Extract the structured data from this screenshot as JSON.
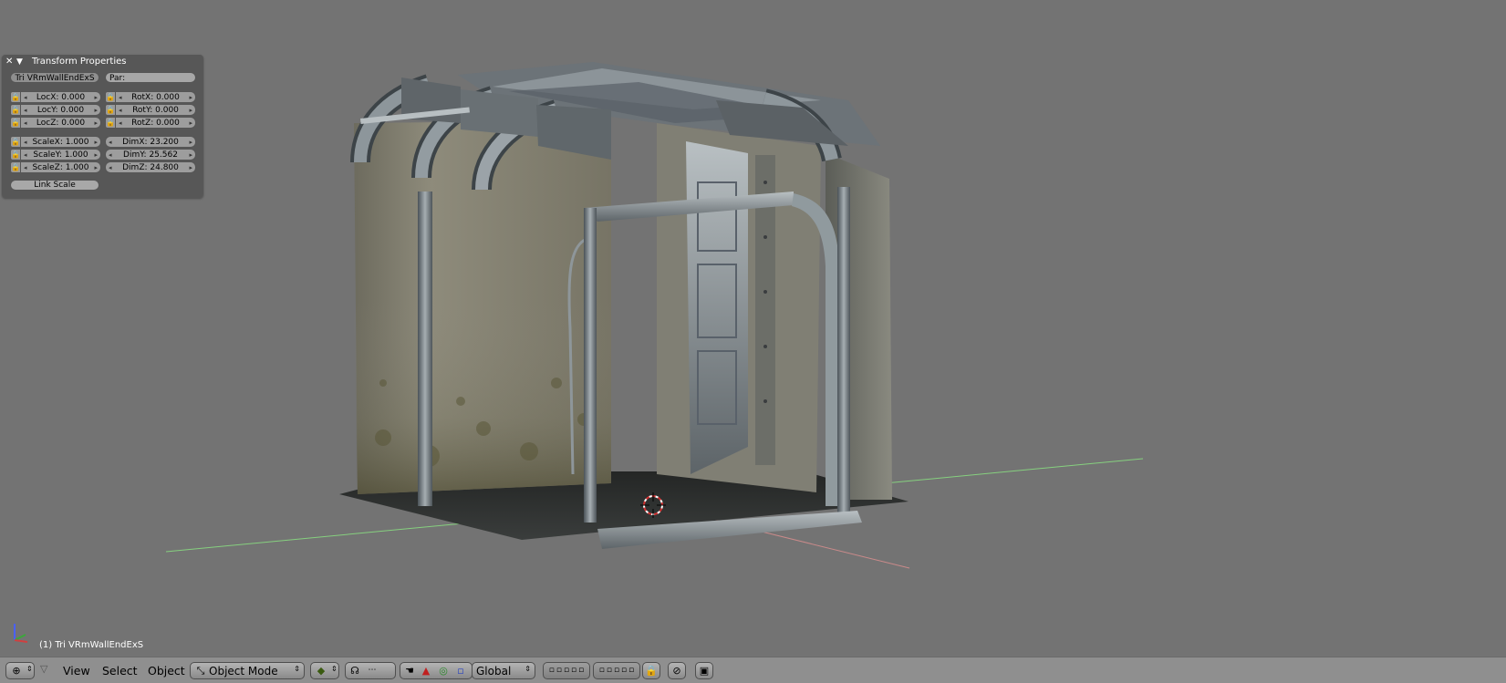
{
  "transform_panel": {
    "title": "Transform Properties",
    "object_name": "Tri VRmWallEndExS",
    "parent_label": "Par:",
    "loc": [
      "LocX: 0.000",
      "LocY: 0.000",
      "LocZ: 0.000"
    ],
    "rot": [
      "RotX: 0.000",
      "RotY: 0.000",
      "RotZ: 0.000"
    ],
    "scale": [
      "ScaleX: 1.000",
      "ScaleY: 1.000",
      "ScaleZ: 1.000"
    ],
    "dim": [
      "DimX: 23.200",
      "DimY: 25.562",
      "DimZ: 24.800"
    ],
    "link_scale": "Link Scale"
  },
  "viewport": {
    "object_label": "(1) Tri VRmWallEndExS"
  },
  "header": {
    "menus": [
      "View",
      "Select",
      "Object"
    ],
    "mode": "Object Mode",
    "orientation": "Global"
  },
  "colors": {
    "viewport_bg": "#737373",
    "x_axis": "#d98f8f",
    "y_axis": "#8fd98f",
    "header_bg": "#8f8f8f"
  }
}
